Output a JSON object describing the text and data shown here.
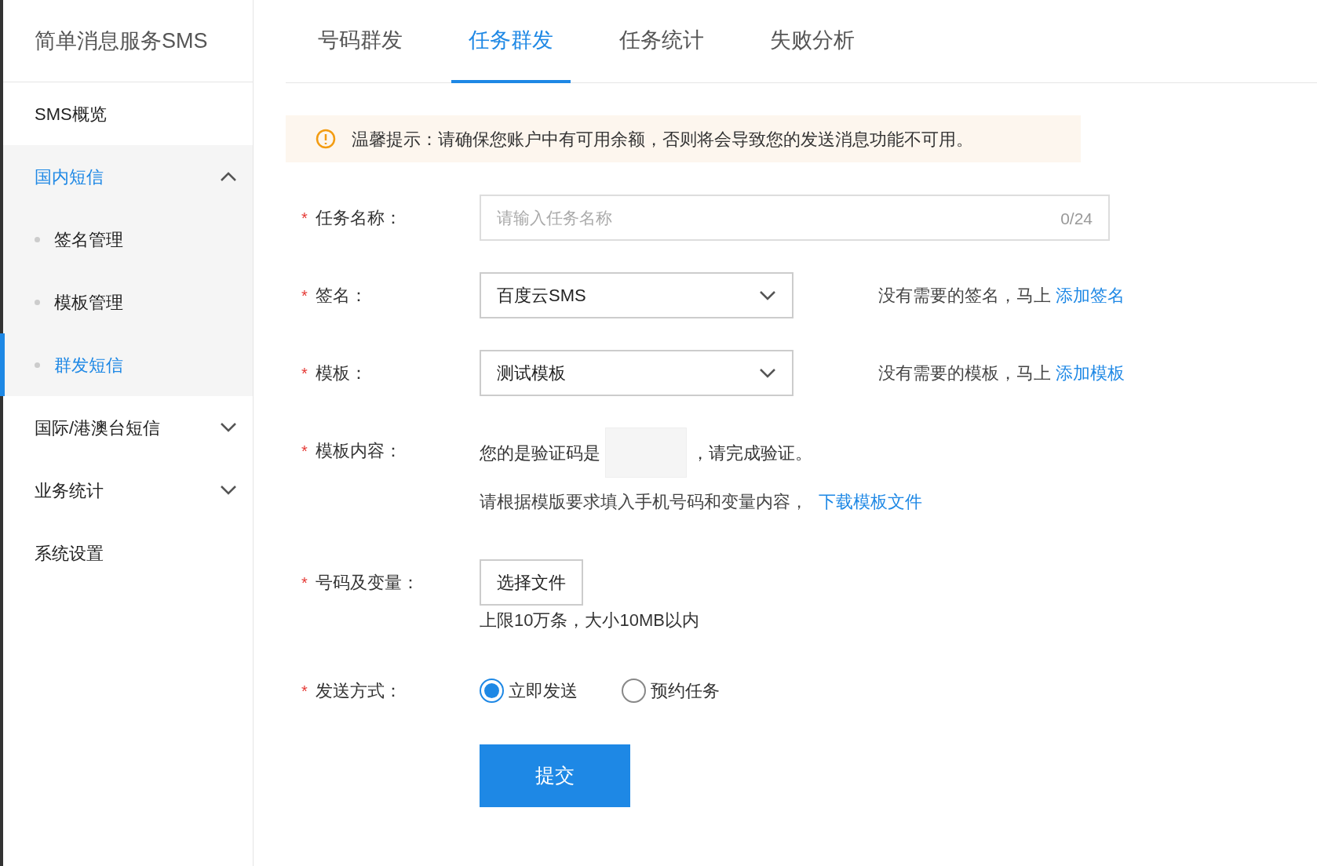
{
  "sidebar": {
    "title": "简单消息服务SMS",
    "items": [
      {
        "label": "SMS概览",
        "kind": "link",
        "selected": false
      },
      {
        "label": "国内短信",
        "kind": "group",
        "expanded": true,
        "children": [
          {
            "label": "签名管理",
            "selected": false
          },
          {
            "label": "模板管理",
            "selected": false
          },
          {
            "label": "群发短信",
            "selected": true
          }
        ]
      },
      {
        "label": "国际/港澳台短信",
        "kind": "group",
        "expanded": false
      },
      {
        "label": "业务统计",
        "kind": "group",
        "expanded": false
      },
      {
        "label": "系统设置",
        "kind": "link",
        "selected": false
      }
    ]
  },
  "tabs": [
    {
      "label": "号码群发",
      "selected": false
    },
    {
      "label": "任务群发",
      "selected": true
    },
    {
      "label": "任务统计",
      "selected": false
    },
    {
      "label": "失败分析",
      "selected": false
    }
  ],
  "notice": "温馨提示：请确保您账户中有可用余额，否则将会导致您的发送消息功能不可用。",
  "form": [
    {
      "kind": "text",
      "label": "任务名称：",
      "marker": "*",
      "placeholder": "请输入任务名称",
      "counter": "0/24"
    },
    {
      "kind": "select",
      "label": "签名：",
      "marker": "*",
      "value": "百度云SMS",
      "hint": "没有需要的签名，马上",
      "link": "添加签名"
    },
    {
      "kind": "select",
      "label": "模板：",
      "marker": "*",
      "value": "测试模板",
      "hint": "没有需要的模板，马上",
      "link": "添加模板"
    },
    {
      "kind": "template",
      "label": "模板内容：",
      "marker": "*",
      "before": "您的是验证码是",
      "after": "，请完成验证。",
      "note": "请根据模版要求填入手机号码和变量内容，",
      "link": "下载模板文件"
    },
    {
      "kind": "file",
      "label": "号码及变量：",
      "marker": "*",
      "button": "选择文件",
      "hint": "上限10万条，大小10MB以内"
    },
    {
      "kind": "radio",
      "label": "发送方式：",
      "marker": "*",
      "options": [
        {
          "label": "立即发送",
          "selected": true
        },
        {
          "label": "预约任务",
          "selected": false
        }
      ]
    }
  ],
  "submit": "提交"
}
